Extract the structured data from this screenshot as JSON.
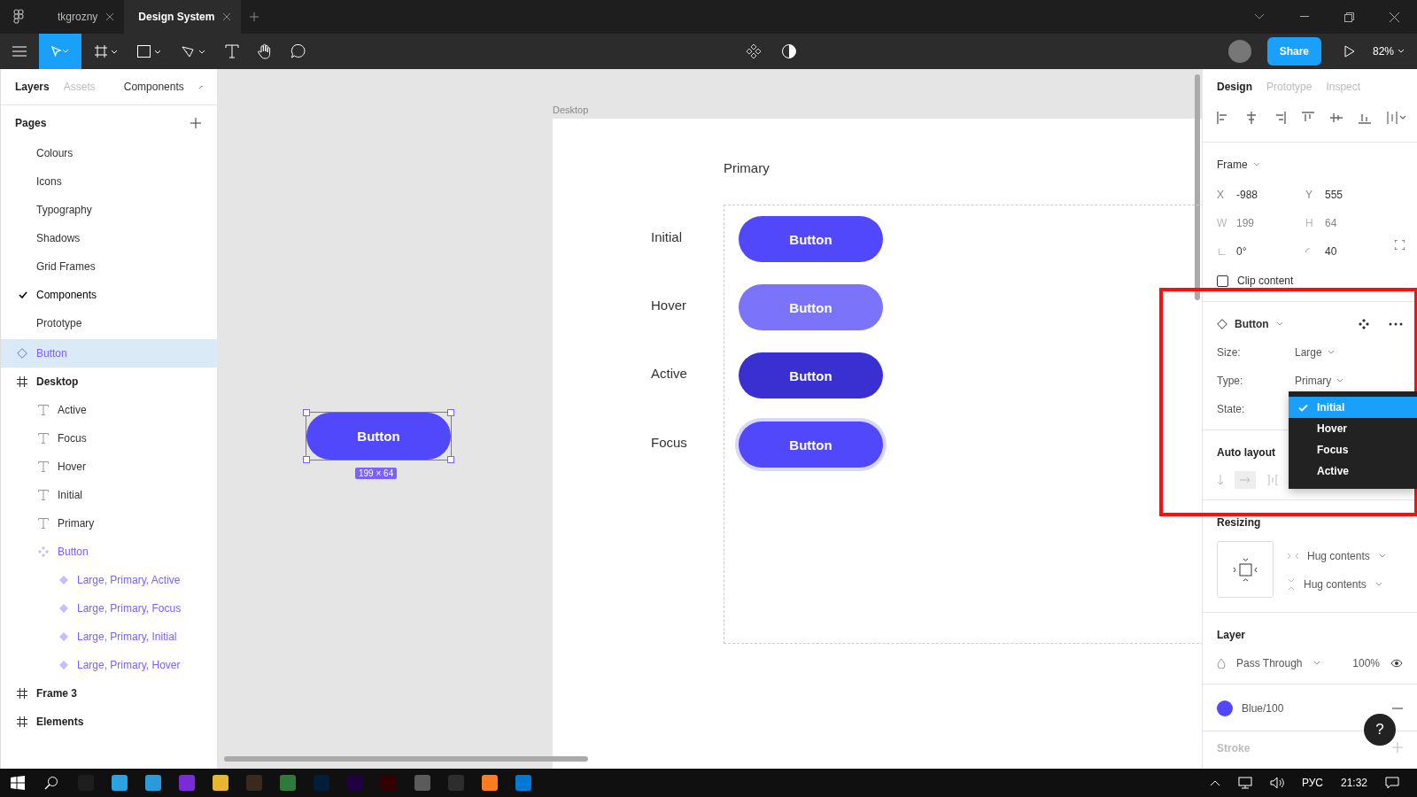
{
  "tabs": [
    {
      "label": "tkgrozny",
      "selected": false
    },
    {
      "label": "Design System",
      "selected": true
    }
  ],
  "toolbar": {
    "share": "Share",
    "zoom": "82%"
  },
  "left_panel": {
    "tabs": [
      {
        "label": "Layers",
        "selected": true
      },
      {
        "label": "Assets",
        "selected": false
      }
    ],
    "page_menu": "Components",
    "pages_title": "Pages",
    "pages": [
      {
        "label": "Colours",
        "selected": false
      },
      {
        "label": "Icons",
        "selected": false
      },
      {
        "label": "Typography",
        "selected": false
      },
      {
        "label": "Shadows",
        "selected": false
      },
      {
        "label": "Grid Frames",
        "selected": false
      },
      {
        "label": "Components",
        "selected": true
      },
      {
        "label": "Prototype",
        "selected": false
      }
    ],
    "layers": [
      {
        "label": "Button",
        "kind": "component",
        "selected": true
      },
      {
        "label": "Desktop",
        "kind": "frame",
        "selected": false,
        "children": [
          {
            "label": "Active",
            "kind": "text",
            "selected": false
          },
          {
            "label": "Focus",
            "kind": "text",
            "selected": false
          },
          {
            "label": "Hover",
            "kind": "text",
            "selected": false
          },
          {
            "label": "Initial",
            "kind": "text",
            "selected": false
          },
          {
            "label": "Primary",
            "kind": "text",
            "selected": false
          },
          {
            "label": "Button",
            "kind": "set",
            "selected": false,
            "children": [
              {
                "label": "Large, Primary, Active",
                "kind": "variant",
                "selected": false
              },
              {
                "label": "Large, Primary, Focus",
                "kind": "variant",
                "selected": false
              },
              {
                "label": "Large, Primary, Initial",
                "kind": "variant",
                "selected": false
              },
              {
                "label": "Large, Primary, Hover",
                "kind": "variant",
                "selected": false
              }
            ]
          }
        ]
      },
      {
        "label": "Frame 3",
        "kind": "frame",
        "selected": false
      },
      {
        "label": "Elements",
        "kind": "frame",
        "selected": false
      }
    ]
  },
  "canvas": {
    "frame_label": "Desktop",
    "heading": "Primary",
    "rows": [
      {
        "label": "Initial",
        "kind": "initial",
        "button": "Button"
      },
      {
        "label": "Hover",
        "kind": "hover",
        "button": "Button"
      },
      {
        "label": "Active",
        "kind": "active",
        "button": "Button"
      },
      {
        "label": "Focus",
        "kind": "focus",
        "button": "Button"
      }
    ],
    "selected_button": {
      "label": "Button",
      "size": "199 × 64"
    }
  },
  "right_panel": {
    "tabs": [
      {
        "label": "Design",
        "selected": true
      },
      {
        "label": "Prototype",
        "selected": false
      },
      {
        "label": "Inspect",
        "selected": false
      }
    ],
    "frame": {
      "title": "Frame",
      "fields": [
        {
          "label": "X",
          "value": "-988",
          "disabled": false
        },
        {
          "label": "Y",
          "value": "555",
          "disabled": false
        },
        {
          "label": "W",
          "value": "199",
          "disabled": true
        },
        {
          "label": "H",
          "value": "64",
          "disabled": true
        },
        {
          "label": "∟",
          "value": "0°",
          "disabled": false
        },
        {
          "label": "◜",
          "value": "40",
          "disabled": false
        }
      ]
    },
    "clip_content": {
      "label": "Clip content",
      "checked": false
    },
    "component": {
      "name": "Button",
      "props": [
        {
          "label": "Size:",
          "value": "Large"
        },
        {
          "label": "Type:",
          "value": "Primary"
        },
        {
          "label": "State:"
        }
      ]
    },
    "state_menu": [
      {
        "label": "Initial",
        "selected": true
      },
      {
        "label": "Hover",
        "selected": false
      },
      {
        "label": "Focus",
        "selected": false
      },
      {
        "label": "Active",
        "selected": false
      }
    ],
    "auto_layout": "Auto layout",
    "resizing": {
      "title": "Resizing",
      "options": [
        "Hug contents",
        "Hug contents"
      ]
    },
    "layer": {
      "title": "Layer",
      "blend": "Pass Through",
      "opacity": "100%"
    },
    "fill": {
      "name": "Blue/100"
    },
    "stroke": "Stroke"
  },
  "help": "?",
  "taskbar": {
    "language": "РУС",
    "time": "21:32"
  }
}
